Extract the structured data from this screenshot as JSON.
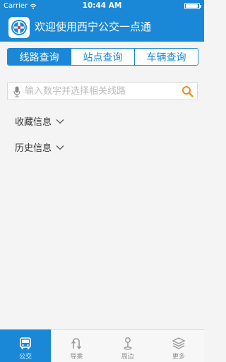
{
  "status_bar": {
    "carrier": "Carrier",
    "time": "10:44 AM"
  },
  "header": {
    "title": "欢迎使用西宁公交一点通",
    "logo_icon": "bus-logo-icon"
  },
  "segmented_tabs": [
    {
      "label": "线路查询",
      "active": true
    },
    {
      "label": "站点查询",
      "active": false
    },
    {
      "label": "车辆查询",
      "active": false
    }
  ],
  "search": {
    "placeholder": "输入数字并选择相关线路",
    "value": ""
  },
  "sections": {
    "favorites_label": "收藏信息",
    "history_label": "历史信息"
  },
  "tabbar": [
    {
      "label": "公交",
      "icon": "bus-icon",
      "active": true
    },
    {
      "label": "导乘",
      "icon": "route-icon",
      "active": false
    },
    {
      "label": "周边",
      "icon": "map-pin-icon",
      "active": false
    },
    {
      "label": "更多",
      "icon": "layers-icon",
      "active": false
    }
  ],
  "colors": {
    "primary": "#1a88d6",
    "search_accent": "#f08c1c",
    "background": "#f4f4f4"
  }
}
